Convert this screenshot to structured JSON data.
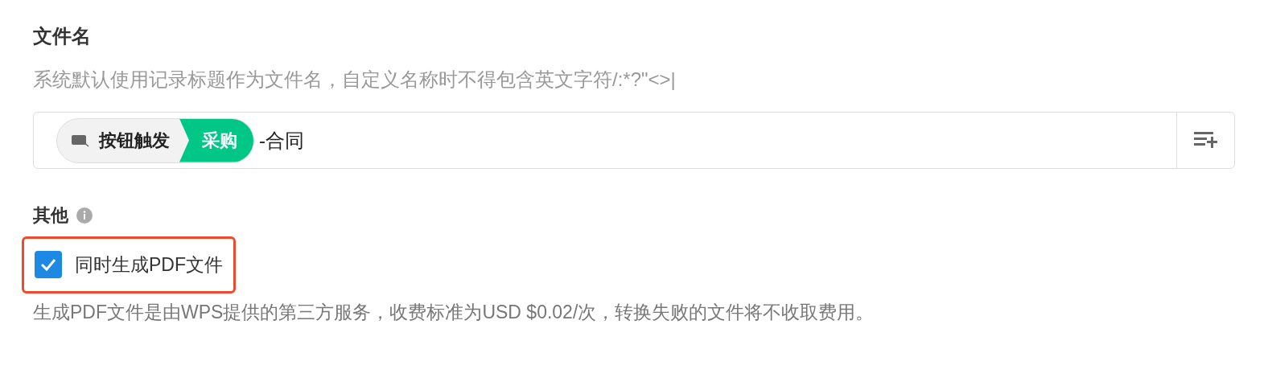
{
  "file_name": {
    "title": "文件名",
    "hint": "系统默认使用记录标题作为文件名，自定义名称时不得包含英文字符/:*?\"<>|",
    "field": {
      "token": {
        "source": "按钮触发",
        "value": "采购"
      },
      "text": "-合同"
    }
  },
  "other": {
    "title": "其他",
    "option": {
      "label": "同时生成PDF文件",
      "checked": true,
      "highlighted": true
    },
    "note": "生成PDF文件是由WPS提供的第三方服务，收费标准为USD $0.02/次，转换失败的文件将不收取费用。"
  }
}
